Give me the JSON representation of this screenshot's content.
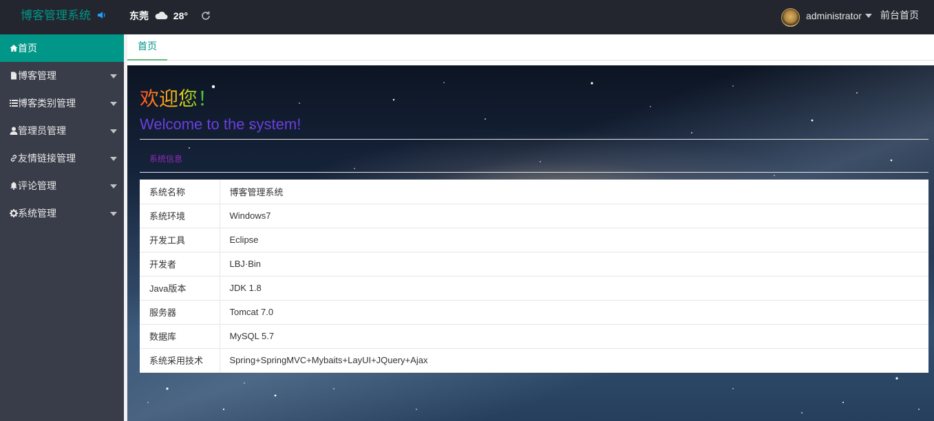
{
  "header": {
    "logo_text": "博客管理系统",
    "city": "东莞",
    "temperature": "28°",
    "user_name": "administrator",
    "front_link": "前台首页"
  },
  "sidebar": {
    "items": [
      {
        "label": "首页",
        "icon": "home-icon",
        "active": true
      },
      {
        "label": "博客管理",
        "icon": "file-icon"
      },
      {
        "label": "博客类别管理",
        "icon": "list-icon"
      },
      {
        "label": "管理员管理",
        "icon": "user-icon"
      },
      {
        "label": "友情链接管理",
        "icon": "link-icon"
      },
      {
        "label": "评论管理",
        "icon": "bell-icon"
      },
      {
        "label": "系统管理",
        "icon": "gear-icon"
      }
    ]
  },
  "tabs": [
    {
      "label": "首页"
    }
  ],
  "main": {
    "welcome_cn": "欢迎您！",
    "welcome_en": "Welcome to the system!",
    "section_title": "系统信息",
    "rows": [
      {
        "key": "系统名称",
        "value": "博客管理系统"
      },
      {
        "key": "系统环境",
        "value": "Windows7"
      },
      {
        "key": "开发工具",
        "value": "Eclipse"
      },
      {
        "key": "开发者",
        "value": "LBJ·Bin"
      },
      {
        "key": "Java版本",
        "value": "JDK 1.8"
      },
      {
        "key": "服务器",
        "value": "Tomcat 7.0"
      },
      {
        "key": "数据库",
        "value": "MySQL 5.7"
      },
      {
        "key": "系统采用技术",
        "value": "Spring+SpringMVC+Mybaits+LayUI+JQuery+Ajax"
      }
    ]
  },
  "colors": {
    "accent": "#009688",
    "header_bg": "#23262e",
    "sidebar_bg": "#393d49"
  }
}
